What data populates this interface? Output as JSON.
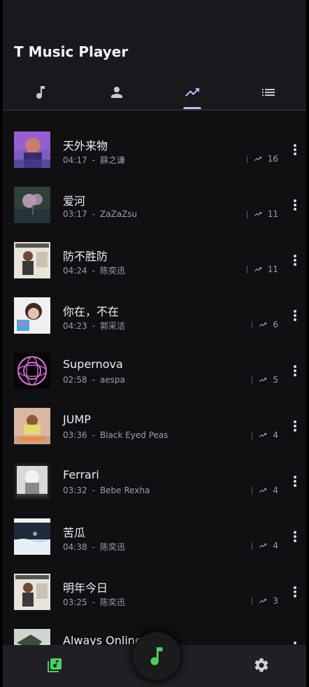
{
  "app": {
    "title": "T Music Player"
  },
  "tabs": [
    {
      "icon": "music-note-icon",
      "active": false
    },
    {
      "icon": "person-icon",
      "active": false
    },
    {
      "icon": "trending-up-icon",
      "active": true
    },
    {
      "icon": "list-icon",
      "active": false
    }
  ],
  "songs": [
    {
      "title": "天外来物",
      "duration": "04:17",
      "separator": "-",
      "artist": "薛之谦",
      "plays": "16"
    },
    {
      "title": "爱河",
      "duration": "03:17",
      "separator": "-",
      "artist": "ZaZaZsu",
      "plays": "11"
    },
    {
      "title": "防不胜防",
      "duration": "04:24",
      "separator": "-",
      "artist": "陈奕迅",
      "plays": "11"
    },
    {
      "title": "你在，不在",
      "duration": "04:23",
      "separator": "-",
      "artist": "郭采洁",
      "plays": "6"
    },
    {
      "title": "Supernova",
      "duration": "02:58",
      "separator": "-",
      "artist": "aespa",
      "plays": "5"
    },
    {
      "title": "JUMP",
      "duration": "03:36",
      "separator": "-",
      "artist": "Black Eyed Peas",
      "plays": "4"
    },
    {
      "title": "Ferrari",
      "duration": "03:32",
      "separator": "-",
      "artist": "Bebe Rexha",
      "plays": "4"
    },
    {
      "title": "苦瓜",
      "duration": "04:38",
      "separator": "-",
      "artist": "陈奕迅",
      "plays": "4"
    },
    {
      "title": "明年今日",
      "duration": "03:25",
      "separator": "-",
      "artist": "陈奕迅",
      "plays": "3"
    },
    {
      "title": "Always Online",
      "duration": "",
      "separator": "",
      "artist": "",
      "plays": ""
    }
  ],
  "bottom_nav": {
    "library_icon": "music-library-icon",
    "player_icon": "music-note-icon",
    "settings_icon": "gear-icon"
  },
  "colors": {
    "accent": "#cfb8f6",
    "fab_icon": "#4ccf62",
    "background": "#101012"
  }
}
